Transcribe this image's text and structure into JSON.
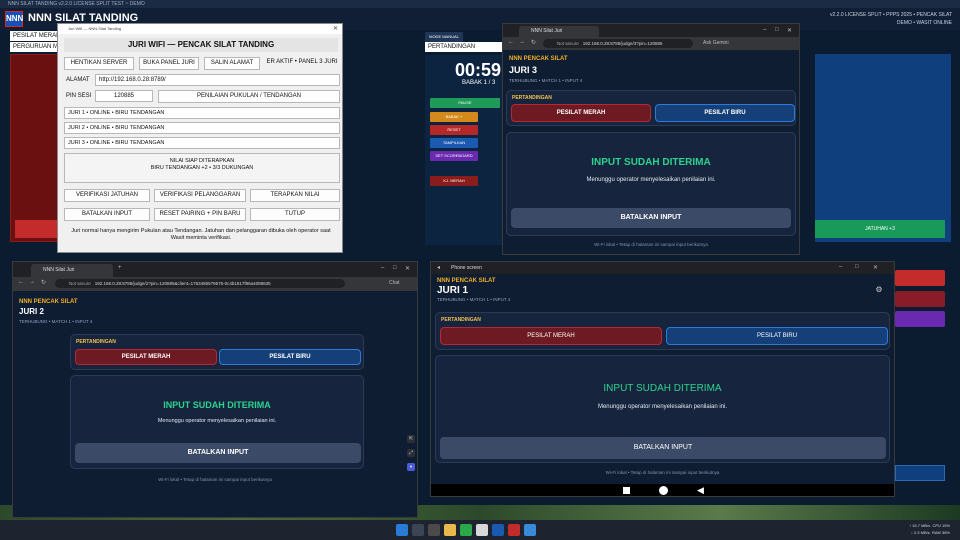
{
  "bg": {
    "topstrip": "NNN SILAT TANDING v2.2.0 LICENSE SPLIT TEST ~ DEMO",
    "logo": "NNN",
    "title": "NNN SILAT TANDING",
    "meta_line1": "v2.2.0 LICENSE SPLIT • PPPS 2025 • PENCAK SILAT",
    "meta_line2": "DEMO • WASIT ONLINE",
    "field_red_name": "PESILAT MERAH",
    "field_red_school": "PERGURUAN M",
    "field_center": "PERTANDINGAN",
    "mode_label": "MODE MANUAL",
    "timer": "00:59",
    "babak": "BABAK 1 / 3",
    "btn_pause": "PAUSE",
    "btn_babak": "BABAK +",
    "btn_reset": "RESET",
    "btn_tampilkan": "TAMPILKAN",
    "btn_scoreboard": "SET SCOREBOARD",
    "btn_kj_merah": "KJ. MERAH",
    "jatuhan_right": "JATUHAN +3",
    "jatuhan_left": ""
  },
  "dialog": {
    "titlebar": "Juri Wifi — NNN Silat Tanding",
    "heading": "JURI WIFI — PENCAK SILAT TANDING",
    "btn_hentikan": "HENTIKAN SERVER",
    "btn_buka_panel": "BUKA PANEL JURI",
    "btn_salin": "SALIN ALAMAT",
    "server_status": "ER AKTIF • PANEL 3 JURI",
    "alamat_label": "ALAMAT",
    "alamat_value": "http://192.168.0.28:8789/",
    "pin_label": "PIN SESI",
    "pin_value": "120885",
    "penilaian_value": "PENILAIAN PUKULAN / TENDANGAN",
    "juri1": "JURI 1 • ONLINE • BIRU TENDANGAN",
    "juri2": "JURI 2 • ONLINE • BIRU TENDANGAN",
    "juri3": "JURI 3 • ONLINE • BIRU TENDANGAN",
    "ready_line1": "NILAI SIAP DITERAPKAN",
    "ready_line2": "BIRU TENDANGAN +2 • 3/3 DUKUNGAN",
    "btn_verif_jatuhan": "VERIFIKASI JATUHAN",
    "btn_verif_pelanggaran": "VERIFIKASI PELANGGARAN",
    "btn_terapkan": "TERAPKAN NILAI",
    "btn_batalkan": "BATALKAN INPUT",
    "btn_reset_pairing": "RESET PAIRING + PIN BARU",
    "btn_tutup": "TUTUP",
    "note": "Juri normal hanya mengirim Pukulan atau Tendangan. Jatuhan dan pelanggaran dibuka oleh operator saat Wasit meminta verifikasi."
  },
  "juri3": {
    "tab": "NNN Silat Juri",
    "url": "192.168.0.28:8789/judge/3?pin=120885",
    "gemini": "Ask Gemini",
    "not_secure": "Not secure",
    "brand": "NNN PENCAK SILAT",
    "juri": "JURI 3",
    "sub": "TERHUBUNG • MATCH 1 • INPUT 4",
    "card_label": "PERTANDINGAN",
    "btn_merah": "PESILAT MERAH",
    "btn_biru": "PESILAT BIRU",
    "input_title": "INPUT SUDAH DITERIMA",
    "input_msg": "Menunggu operator menyelesaikan penilaian ini.",
    "btn_cancel": "BATALKAN INPUT",
    "footnote": "Wi-Fi lokal • Tetap di halaman ini sampai input berikutnya"
  },
  "juri2": {
    "tab": "NNN Silat Juri",
    "url": "192.168.0.28:8789/judge/2?pin=120885&client=1763485579575-0c4b1817f86a4088635",
    "chat": "Chat",
    "not_secure": "Not secure",
    "brand": "NNN PENCAK SILAT",
    "juri": "JURI 2",
    "sub": "TERHUBUNG • MATCH 1 • INPUT 4",
    "card_label": "PERTANDINGAN",
    "btn_merah": "PESILAT MERAH",
    "btn_biru": "PESILAT BIRU",
    "input_title": "INPUT SUDAH DITERIMA",
    "input_msg": "Menunggu operator menyelesaikan penilaian ini.",
    "btn_cancel": "BATALKAN INPUT",
    "footnote": "Wi-Fi lokal • Tetap di halaman ini sampai input berikutnya"
  },
  "juri1": {
    "titlebar": "Phone screen",
    "brand": "NNN PENCAK SILAT",
    "juri": "JURI 1",
    "sub": "TERHUBUNG • MATCH 1 • INPUT 4",
    "card_label": "PERTANDINGAN",
    "btn_merah": "PESILAT MERAH",
    "btn_biru": "PESILAT BIRU",
    "input_title": "INPUT SUDAH DITERIMA",
    "input_msg": "Menunggu operator menyelesaikan penilaian ini.",
    "btn_cancel": "BATALKAN INPUT",
    "footnote": "Wi-Fi lokal • Tetap di halaman ini sampai input berikutnya"
  },
  "taskbar": {
    "net1": "↑ 15.7 MB/s",
    "net2": "↓ 2.3 MB/s",
    "cpu": "CPU 15%",
    "ram": "RAM 38%"
  },
  "colors": {
    "accent_green": "#2fd28f",
    "brand_gold": "#f2b024",
    "red": "#b02a37",
    "blue": "#2f7ad8"
  }
}
